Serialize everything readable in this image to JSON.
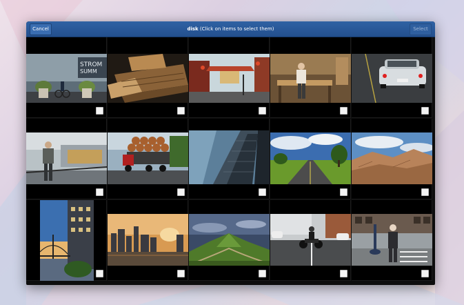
{
  "dialog": {
    "cancel_label": "Cancel",
    "select_label": "Select",
    "title_bold": "disk",
    "title_rest": " (Click on items to select them)"
  },
  "colors": {
    "header": "#2a5a9c",
    "grid_bg": "#000000",
    "checkbox": "#f4f4f4"
  },
  "photos": [
    {
      "name": "street-cyclist-photo",
      "selected": false
    },
    {
      "name": "wooden-planks-photo",
      "selected": false
    },
    {
      "name": "chinatown-street-photo",
      "selected": false
    },
    {
      "name": "carpenter-workshop-photo",
      "selected": false
    },
    {
      "name": "vintage-car-photo",
      "selected": false
    },
    {
      "name": "photographer-pier-photo",
      "selected": false
    },
    {
      "name": "log-truck-photo",
      "selected": false
    },
    {
      "name": "skyscraper-photo",
      "selected": false
    },
    {
      "name": "country-road-photo",
      "selected": false
    },
    {
      "name": "desert-badlands-photo",
      "selected": false
    },
    {
      "name": "bay-bridge-photo",
      "selected": false
    },
    {
      "name": "city-sunset-photo",
      "selected": false
    },
    {
      "name": "green-hills-photo",
      "selected": false
    },
    {
      "name": "motorcycle-street-photo",
      "selected": false
    },
    {
      "name": "old-man-street-photo",
      "selected": false
    }
  ]
}
